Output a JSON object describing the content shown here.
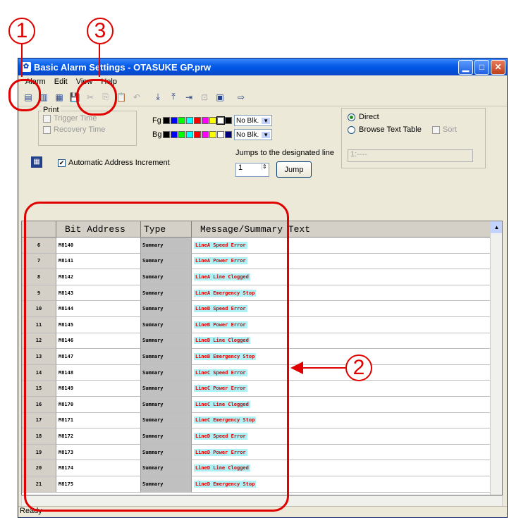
{
  "window": {
    "title": "Basic Alarm Settings - OTASUKE GP.prw"
  },
  "menu": [
    "Alarm",
    "Edit",
    "View",
    "Help"
  ],
  "callouts": [
    "1",
    "2",
    "3"
  ],
  "print": {
    "legend": "Print",
    "trigger_time": "Trigger Time",
    "recovery_time": "Recovery Time"
  },
  "colors": {
    "fg_label": "Fg",
    "bg_label": "Bg",
    "blink": "No Blk.",
    "palette": [
      "#000000",
      "#0000ff",
      "#00ff00",
      "#00ffff",
      "#ff0000",
      "#ff00ff",
      "#ffff00",
      "#ffffff"
    ]
  },
  "source": {
    "direct": "Direct",
    "browse": "Browse Text Table",
    "sort": "Sort",
    "table_placeholder": "1:----"
  },
  "auto_address": "Automatic Address Increment",
  "jump": {
    "label": "Jumps to the designated line",
    "value": "1",
    "button": "Jump"
  },
  "grid": {
    "headers": [
      "Bit Address",
      "Type",
      "Message/Summary Text"
    ],
    "rows": [
      {
        "num": "6",
        "addr": "M8140",
        "type": "Summary",
        "msg": "LineA Speed Error"
      },
      {
        "num": "7",
        "addr": "M8141",
        "type": "Summary",
        "msg": "LineA Power Error"
      },
      {
        "num": "8",
        "addr": "M8142",
        "type": "Summary",
        "msg": "LineA Line Clogged"
      },
      {
        "num": "9",
        "addr": "M8143",
        "type": "Summary",
        "msg": "LineA Emergency Stop"
      },
      {
        "num": "10",
        "addr": "M8144",
        "type": "Summary",
        "msg": "LineB Speed Error"
      },
      {
        "num": "11",
        "addr": "M8145",
        "type": "Summary",
        "msg": "LineB Power Error"
      },
      {
        "num": "12",
        "addr": "M8146",
        "type": "Summary",
        "msg": "LineB Line Clogged"
      },
      {
        "num": "13",
        "addr": "M8147",
        "type": "Summary",
        "msg": "LineB Emergency Stop"
      },
      {
        "num": "14",
        "addr": "M8148",
        "type": "Summary",
        "msg": "LineC Speed Error"
      },
      {
        "num": "15",
        "addr": "M8149",
        "type": "Summary",
        "msg": "LineC Power Error"
      },
      {
        "num": "16",
        "addr": "M8170",
        "type": "Summary",
        "msg": "LineC Line Clogged"
      },
      {
        "num": "17",
        "addr": "M8171",
        "type": "Summary",
        "msg": "LineC Emergency Stop"
      },
      {
        "num": "18",
        "addr": "M8172",
        "type": "Summary",
        "msg": "LineD Speed Error"
      },
      {
        "num": "19",
        "addr": "M8173",
        "type": "Summary",
        "msg": "LineD Power Error"
      },
      {
        "num": "20",
        "addr": "M8174",
        "type": "Summary",
        "msg": "LineD Line Clogged"
      },
      {
        "num": "21",
        "addr": "M8175",
        "type": "Summary",
        "msg": "LineD Emergency Stop"
      }
    ]
  },
  "status": "Ready"
}
